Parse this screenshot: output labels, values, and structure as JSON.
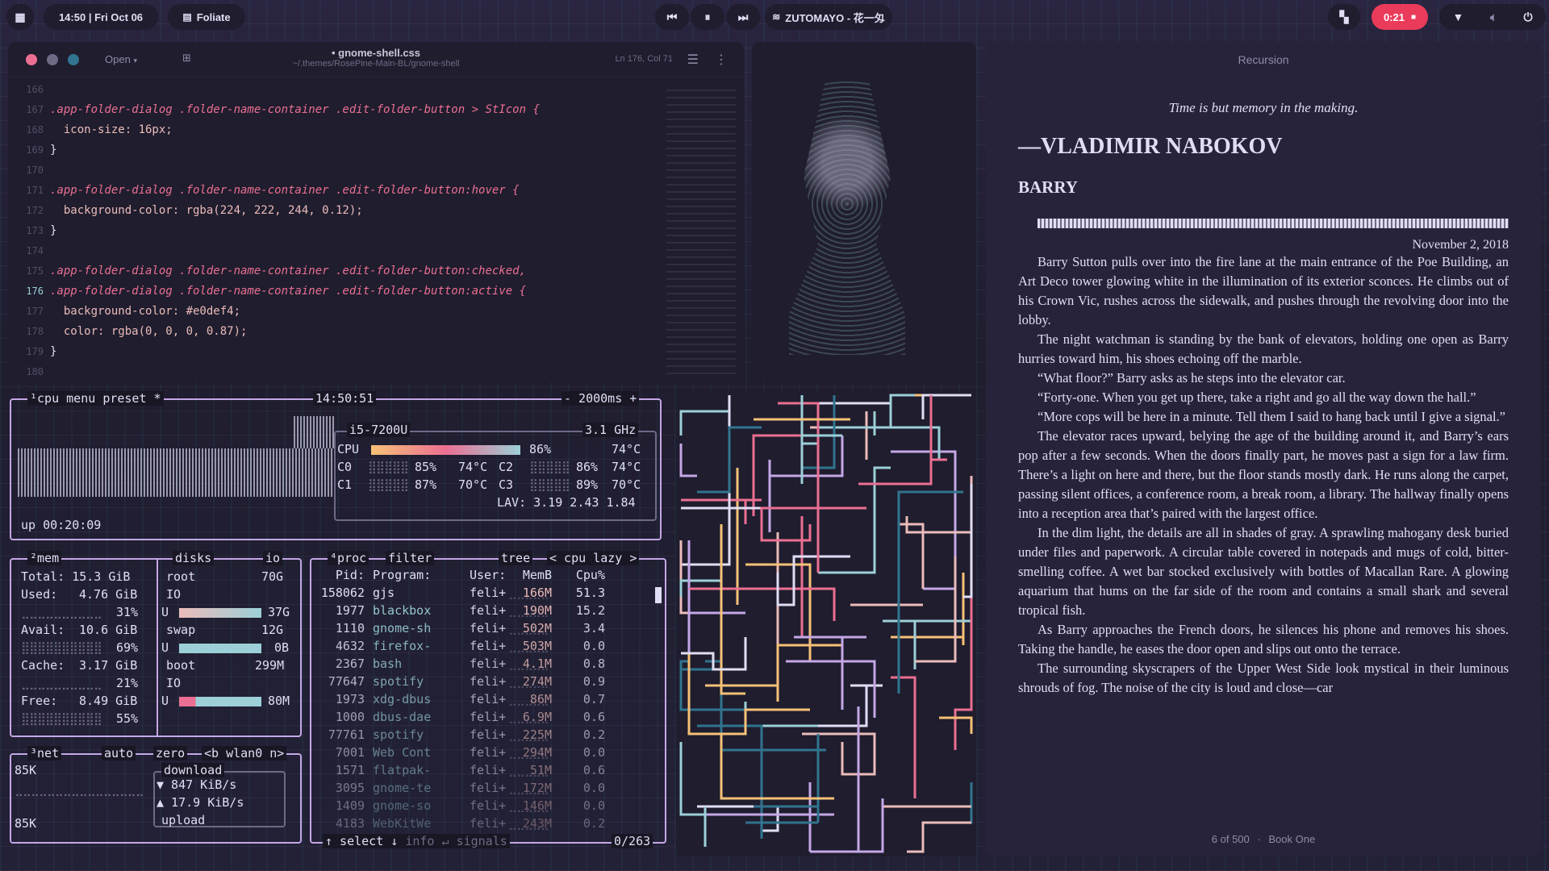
{
  "topbar": {
    "datetime": "14:50 | Fri Oct 06",
    "app_name": "Foliate",
    "now_playing": "ZUTOMAYO - 花一匁",
    "record_time": "0:21"
  },
  "editor": {
    "open_label": "Open",
    "filename": "• gnome-shell.css",
    "path": "~/.themes/RosePine-Main-BL/gnome-shell",
    "cursor_pos": "Ln 176, Col 71",
    "lines": [
      {
        "n": "166",
        "text": ""
      },
      {
        "n": "167",
        "text": ".app-folder-dialog .folder-name-container .edit-folder-button > StIcon {"
      },
      {
        "n": "168",
        "text": "  icon-size: 16px;"
      },
      {
        "n": "169",
        "text": "}"
      },
      {
        "n": "170",
        "text": ""
      },
      {
        "n": "171",
        "text": ".app-folder-dialog .folder-name-container .edit-folder-button:hover {"
      },
      {
        "n": "172",
        "text": "  background-color: rgba(224, 222, 244, 0.12);"
      },
      {
        "n": "173",
        "text": "}"
      },
      {
        "n": "174",
        "text": ""
      },
      {
        "n": "175",
        "text": ".app-folder-dialog .folder-name-container .edit-folder-button:checked,"
      },
      {
        "n": "176",
        "text": ".app-folder-dialog .folder-name-container .edit-folder-button:active {"
      },
      {
        "n": "177",
        "text": "  background-color: #e0def4;"
      },
      {
        "n": "178",
        "text": "  color: rgba(0, 0, 0, 0.87);"
      },
      {
        "n": "179",
        "text": "}"
      },
      {
        "n": "180",
        "text": ""
      }
    ]
  },
  "btop": {
    "cpu_box": {
      "label": "¹cpu",
      "menu": "menu",
      "preset": "preset *",
      "clock": "14:50:51",
      "interval": "- 2000ms +",
      "uptime": "up 00:20:09"
    },
    "cpu_info": {
      "model": "i5-7200U",
      "freq": "3.1 GHz",
      "total_label": "CPU",
      "total_pct": "86%",
      "total_temp": "74°C",
      "cores": [
        {
          "name": "C0",
          "pct": "85%",
          "temp": "74°C"
        },
        {
          "name": "C2",
          "pct": "86%",
          "temp": "74°C"
        },
        {
          "name": "C1",
          "pct": "87%",
          "temp": "70°C"
        },
        {
          "name": "C3",
          "pct": "89%",
          "temp": "70°C"
        }
      ],
      "lav": "LAV: 3.19 2.43 1.84"
    },
    "mem": {
      "label": "²mem",
      "disks_label": "disks",
      "io_label": "io",
      "total": "Total: 15.3 GiB",
      "used_label": "Used:",
      "used": "4.76 GiB",
      "used_pct": "31%",
      "avail_label": "Avail:",
      "avail": "10.6 GiB",
      "avail_pct": "69%",
      "cache_label": "Cache:",
      "cache": "3.17 GiB",
      "cache_pct": "21%",
      "free_label": "Free:",
      "free": "8.49 GiB",
      "free_pct": "55%"
    },
    "disks": [
      {
        "name": "root",
        "size": "70G",
        "io": "IO",
        "u": "U",
        "used": "37G"
      },
      {
        "name": "swap",
        "size": "12G",
        "io": "",
        "u": "U",
        "used": "0B"
      },
      {
        "name": "boot",
        "size": "299M",
        "io": "IO",
        "u": "U",
        "used": "80M"
      }
    ],
    "net": {
      "label": "³net",
      "auto": "auto",
      "zero": "zero",
      "iface": "<b wlan0 n>",
      "top": "85K",
      "bottom": "85K",
      "download_label": "download",
      "download": "▼ 847 KiB/s",
      "upload": "▲ 17.9 KiB/s",
      "upload_label": "upload"
    },
    "proc": {
      "label": "⁴proc",
      "filter": "filter",
      "tree": "tree",
      "sort": "< cpu lazy >",
      "headers": [
        "Pid:",
        "Program:",
        "User:",
        "MemB",
        "Cpu%"
      ],
      "rows": [
        [
          "158062",
          "gjs",
          "feli+",
          "166M",
          "51.3"
        ],
        [
          "1977",
          "blackbox",
          "feli+",
          "190M",
          "15.2"
        ],
        [
          "1110",
          "gnome-sh",
          "feli+",
          "502M",
          "3.4"
        ],
        [
          "4632",
          "firefox-",
          "feli+",
          "503M",
          "0.0"
        ],
        [
          "2367",
          "bash",
          "feli+",
          "4.1M",
          "0.8"
        ],
        [
          "77647",
          "spotify",
          "feli+",
          "274M",
          "0.9"
        ],
        [
          "1973",
          "xdg-dbus",
          "feli+",
          "86M",
          "0.7"
        ],
        [
          "1000",
          "dbus-dae",
          "feli+",
          "6.9M",
          "0.6"
        ],
        [
          "77761",
          "spotify",
          "feli+",
          "225M",
          "0.2"
        ],
        [
          "7001",
          "Web Cont",
          "feli+",
          "294M",
          "0.0"
        ],
        [
          "1571",
          "flatpak-",
          "feli+",
          "51M",
          "0.6"
        ],
        [
          "3095",
          "gnome-te",
          "feli+",
          "172M",
          "0.0"
        ],
        [
          "1409",
          "gnome-so",
          "feli+",
          "146M",
          "0.0"
        ],
        [
          "4183",
          "WebKitWe",
          "feli+",
          "243M",
          "0.2"
        ]
      ],
      "footer_select": "↑ select ↓",
      "footer_info": "info ↵",
      "footer_signals": "signals",
      "footer_count": "0/263"
    }
  },
  "reader": {
    "header": "Recursion",
    "epigraph": "Time is but memory in the making.",
    "author": "—VLADIMIR NABOKOV",
    "chapter": "BARRY",
    "date": "November 2, 2018",
    "paragraphs": [
      "Barry Sutton pulls over into the fire lane at the main entrance of the Poe Building, an Art Deco tower glowing white in the illumination of its exterior sconces. He climbs out of his Crown Vic, rushes across the sidewalk, and pushes through the revolving door into the lobby.",
      "The night watchman is standing by the bank of elevators, holding one open as Barry hurries toward him, his shoes echoing off the marble.",
      "“What floor?” Barry asks as he steps into the elevator car.",
      "“Forty-one. When you get up there, take a right and go all the way down the hall.”",
      "“More cops will be here in a minute. Tell them I said to hang back until I give a signal.”",
      "The elevator races upward, belying the age of the building around it, and Barry’s ears pop after a few seconds. When the doors finally part, he moves past a sign for a law firm. There’s a light on here and there, but the floor stands mostly dark. He runs along the carpet, passing silent offices, a conference room, a break room, a library. The hallway finally opens into a reception area that’s paired with the largest office.",
      "In the dim light, the details are all in shades of gray. A sprawling mahogany desk buried under files and paperwork. A circular table covered in notepads and mugs of cold, bitter-smelling coffee. A wet bar stocked exclusively with bottles of Macallan Rare. A glowing aquarium that hums on the far side of the room and contains a small shark and several tropical fish.",
      "As Barry approaches the French doors, he silences his phone and removes his shoes. Taking the handle, he eases the door open and slips out onto the terrace.",
      "The surrounding skyscrapers of the Upper West Side look mystical in their luminous shrouds of fog. The noise of the city is loud and close—car"
    ],
    "progress": "6 of 500",
    "book": "Book One"
  },
  "colors": {
    "base": "#191724",
    "surface": "#1f1d2e",
    "overlay": "#26233a",
    "love": "#eb6f92",
    "rose": "#ebbcba",
    "foam": "#9ccfd8",
    "iris": "#c4a7e7",
    "gold": "#f6c177"
  }
}
